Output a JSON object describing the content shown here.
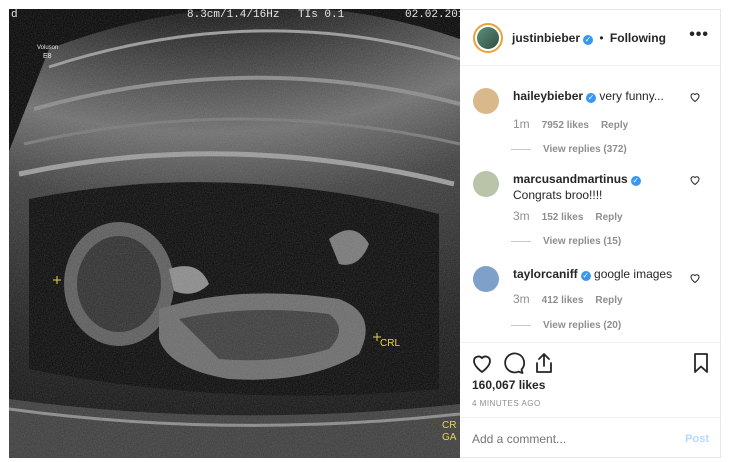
{
  "ultrasound": {
    "corner_left": "d",
    "params": "8.3cm/1.4/16Hz",
    "tis": "TIs  0.1",
    "date": "02.02.201",
    "brand": "Voluson",
    "model": "E8",
    "crl_marker": "CRL",
    "bottom_label_1": "CR",
    "bottom_label_2": "GA"
  },
  "header": {
    "username": "justinbieber",
    "separator": "•",
    "follow_status": "Following",
    "more_label": "•••"
  },
  "comments": [
    {
      "username": "haileybieber",
      "verified": true,
      "text": "very funny...",
      "time": "1m",
      "likes": "7952 likes",
      "reply": "Reply",
      "view_replies": "View replies (372)",
      "avatar_color": "#d9b98c"
    },
    {
      "username": "marcusandmartinus",
      "verified": true,
      "text": "Congrats broo!!!!",
      "time": "3m",
      "likes": "152 likes",
      "reply": "Reply",
      "view_replies": "View replies (15)",
      "avatar_color": "#b9c4a8"
    },
    {
      "username": "taylorcaniff",
      "verified": true,
      "text": "google images",
      "time": "3m",
      "likes": "412 likes",
      "reply": "Reply",
      "view_replies": "View replies (20)",
      "avatar_color": "#7fa0c9"
    }
  ],
  "post": {
    "like_count": "160,067 likes",
    "time_ago": "4 MINUTES AGO",
    "comment_placeholder": "Add a comment...",
    "post_label": "Post"
  },
  "icons": {
    "like": "heart-icon",
    "comment": "comment-icon",
    "share": "share-icon",
    "save": "bookmark-icon",
    "comment_like": "heart-icon",
    "verified": "verified-badge-icon"
  },
  "colors": {
    "verified": "#3897f0",
    "story_ring": "#e7a238",
    "post_disabled": "#b3dbff",
    "muted_text": "#8e8e8e"
  }
}
